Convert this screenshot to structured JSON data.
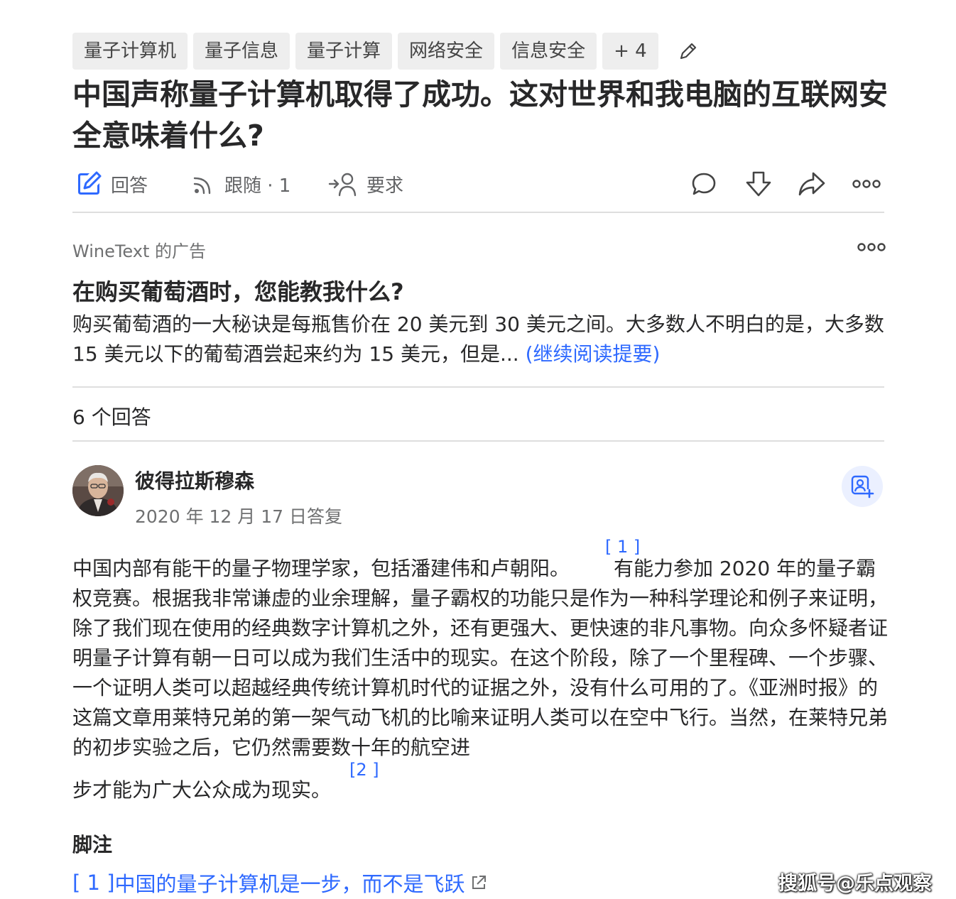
{
  "topics": [
    "量子计算机",
    "量子信息",
    "量子计算",
    "网络安全",
    "信息安全",
    "+ 4"
  ],
  "question": {
    "title": "中国声称量子计算机取得了成功。这对世界和我电脑的互联网安全意味着什么?"
  },
  "actions": {
    "answer_label": "回答",
    "follow_label": "跟随 · 1",
    "request_label": "要求"
  },
  "ad": {
    "source": "WineText 的广告",
    "title": "在购买葡萄酒时，您能教我什么?",
    "body": "购买葡萄酒的一大秘诀是每瓶售价在 20 美元到 30 美元之间。大多数人不明白的是，大多数 15 美元以下的葡萄酒尝起来约为 15 美元，但是...",
    "link": "(继续阅读提要)"
  },
  "answers_count": "6 个回答",
  "answer": {
    "author": "彼得拉斯穆森",
    "date": "2020 年 12 月 17 日答复",
    "cite1": "[ 1 ]",
    "cite2": "[2 ]",
    "para_part1": "中国内部有能干的量子物理学家，包括潘建伟和卢朝阳。",
    "para_part2": "有能力参加 2020 年的量子霸权竞赛。根据我非常谦虚的业余理解，量子霸权的功能只是作为一种科学理论和例子来证明，除了我们现在使用的经典数字计算机之外，还有更强大、更快速的非凡事物。向众多怀疑者证明量子计算有朝一日可以成为我们生活中的现实。在这个阶段，除了一个里程碑、一个步骤、一个证明人类可以超越经典传统计算机时代的证据之外，没有什么可用的了。《亚洲时报》的这篇文章用莱特兄弟的第一架气动飞机的比喻来证明人类可以在空中飞行。当然，在莱特兄弟的初步实验之后，它仍然需要数十年的航空进",
    "para_part3": "步才能为广大公众成为现实。"
  },
  "footnotes": {
    "title": "脚注",
    "items": [
      {
        "ref": "[ 1 ]",
        "text": "中国的量子计算机是一步，而不是飞跃"
      }
    ]
  },
  "watermark": "搜狐号@乐点观察",
  "colors": {
    "link_blue": "#2e69ff",
    "text": "#282829",
    "muted": "#636466",
    "chip_bg": "#eeeeee"
  }
}
